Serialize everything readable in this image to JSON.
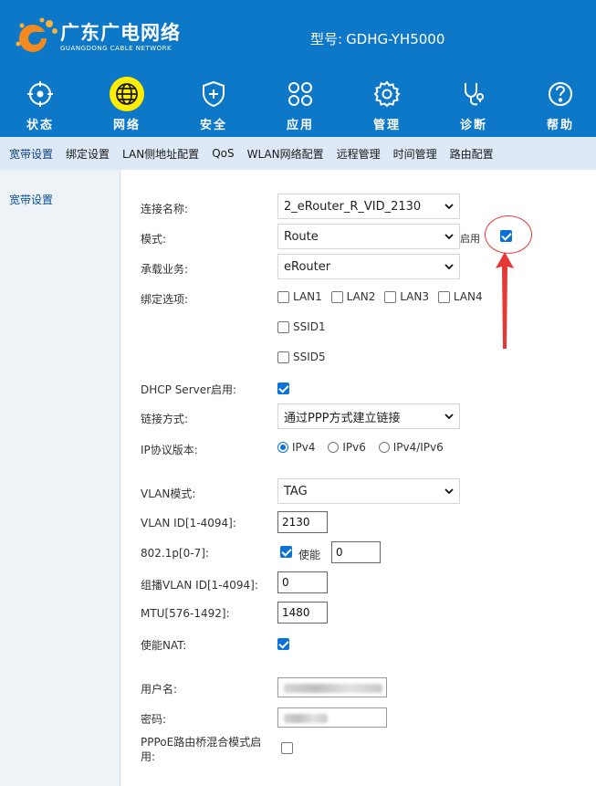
{
  "header": {
    "brand_cn": "广东广电网络",
    "brand_en": "GUANGDONG CABLE NETWORK",
    "model_label": "型号:",
    "model_value": "GDHG-YH5000",
    "colors": {
      "bg": "#0e78c8",
      "active": "#ffee00"
    }
  },
  "nav": [
    {
      "label": "状态",
      "icon": "crosshair-icon"
    },
    {
      "label": "网络",
      "icon": "globe-icon",
      "active": true
    },
    {
      "label": "安全",
      "icon": "shield-plus-icon"
    },
    {
      "label": "应用",
      "icon": "clover-icon"
    },
    {
      "label": "管理",
      "icon": "gear-icon"
    },
    {
      "label": "诊断",
      "icon": "stethoscope-icon"
    },
    {
      "label": "帮助",
      "icon": "help-icon"
    }
  ],
  "subnav": [
    "宽带设置",
    "绑定设置",
    "LAN侧地址配置",
    "QoS",
    "WLAN网络配置",
    "远程管理",
    "时间管理",
    "路由配置"
  ],
  "sidebar": {
    "item": "宽带设置"
  },
  "form": {
    "connection_name": {
      "label": "连接名称:",
      "value": "2_eRouter_R_VID_2130"
    },
    "mode": {
      "label": "模式:",
      "value": "Route",
      "enable_label": "启用",
      "enabled": true
    },
    "service": {
      "label": "承载业务:",
      "value": "eRouter"
    },
    "bind": {
      "label": "绑定选项:",
      "options": [
        {
          "label": "LAN1",
          "checked": false
        },
        {
          "label": "LAN2",
          "checked": false
        },
        {
          "label": "LAN3",
          "checked": false
        },
        {
          "label": "LAN4",
          "checked": false
        },
        {
          "label": "SSID1",
          "checked": false
        },
        {
          "label": "SSID5",
          "checked": false
        }
      ]
    },
    "dhcp": {
      "label": "DHCP Server启用:",
      "checked": true
    },
    "link_mode": {
      "label": "链接方式:",
      "value": "通过PPP方式建立链接"
    },
    "ip_version": {
      "label": "IP协议版本:",
      "options": [
        {
          "label": "IPv4",
          "checked": true
        },
        {
          "label": "IPv6",
          "checked": false
        },
        {
          "label": "IPv4/IPv6",
          "checked": false
        }
      ]
    },
    "vlan_mode": {
      "label": "VLAN模式:",
      "value": "TAG"
    },
    "vlan_id": {
      "label": "VLAN ID[1-4094]:",
      "value": "2130"
    },
    "dot1p": {
      "label": "802.1p[0-7]:",
      "enable_label": "使能",
      "checked": true,
      "value": "0"
    },
    "mcast_vlan": {
      "label": "组播VLAN ID[1-4094]:",
      "value": "0"
    },
    "mtu": {
      "label": "MTU[576-1492]:",
      "value": "1480"
    },
    "nat": {
      "label": "使能NAT:",
      "checked": true
    },
    "username": {
      "label": "用户名:"
    },
    "password": {
      "label": "密码:"
    },
    "pppoe_bridge": {
      "label_line1": "PPPoE路由桥混合模式启",
      "label_line2": "用:",
      "checked": false
    }
  },
  "annotation": {
    "color": "#e53935"
  }
}
